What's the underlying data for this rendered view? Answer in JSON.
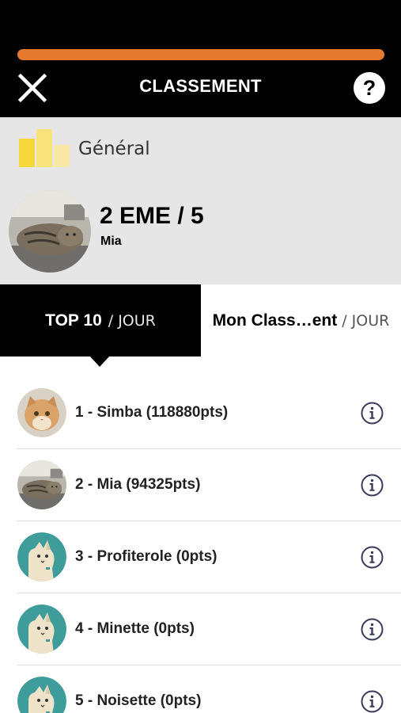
{
  "header": {
    "title": "CLASSEMENT",
    "close_icon": "close-icon",
    "help_label": "?",
    "accent_color": "#e47a2e"
  },
  "profile": {
    "category": "Général",
    "category_icon": "bar-chart-icon",
    "rank": "2 EME / 5",
    "name": "Mia"
  },
  "tabs": [
    {
      "label": "TOP 10",
      "period": "/ JOUR",
      "active": true
    },
    {
      "label": "Mon Class…ent",
      "period": "/ JOUR",
      "active": false
    }
  ],
  "ranking": [
    {
      "label": "1 - Simba (118880pts)",
      "avatar": "cat-photo-orange"
    },
    {
      "label": "2 - Mia (94325pts)",
      "avatar": "cat-photo-tabby"
    },
    {
      "label": "3 - Profiterole (0pts)",
      "avatar": "default-cat-avatar"
    },
    {
      "label": "4 - Minette (0pts)",
      "avatar": "default-cat-avatar"
    },
    {
      "label": "5 - Noisette (0pts)",
      "avatar": "default-cat-avatar"
    }
  ],
  "colors": {
    "header_bg": "#000000",
    "profile_bg": "#e6e6e6",
    "default_avatar_bg": "#3e9d9b",
    "info_icon": "#3a3a5a"
  }
}
